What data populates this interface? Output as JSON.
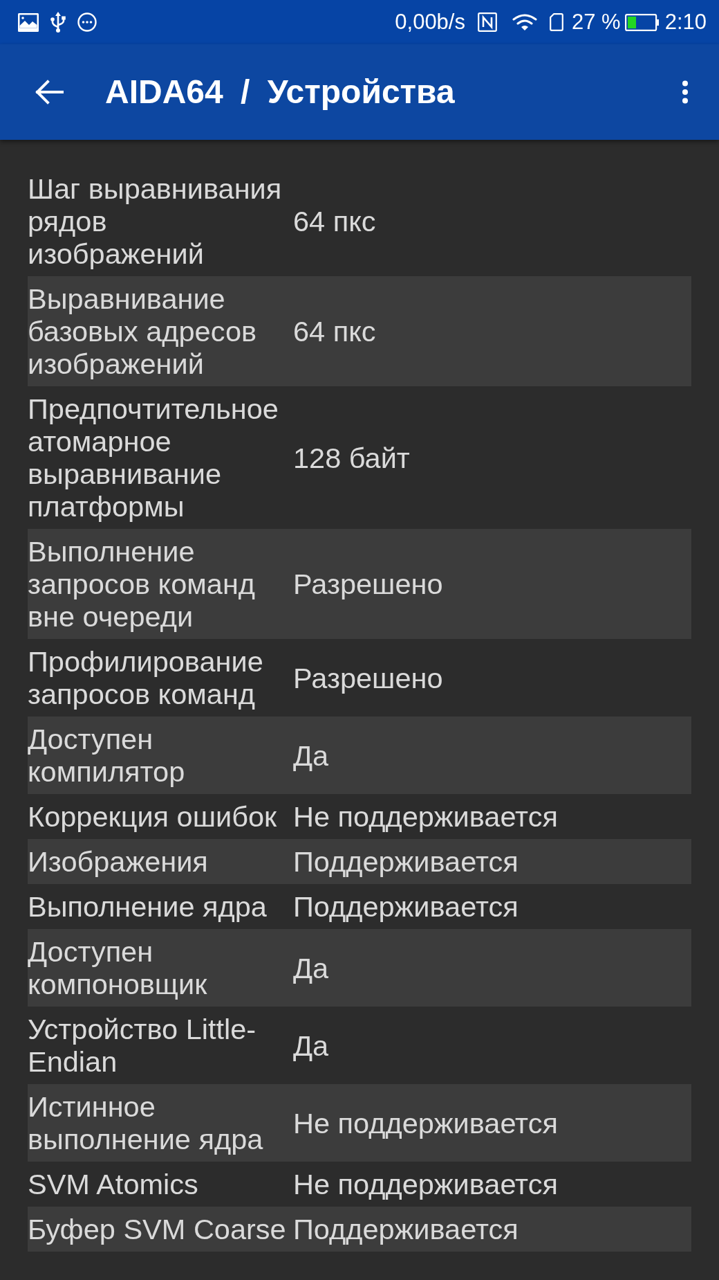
{
  "status_bar": {
    "network_speed": "0,00b/s",
    "battery_percent": "27 %",
    "time": "2:10"
  },
  "app_bar": {
    "title": "AIDA64 / Устройства"
  },
  "rows": [
    {
      "label": "Шаг выравнивания рядов изображений",
      "value": "64 пкс"
    },
    {
      "label": "Выравнивание базовых адресов изображений",
      "value": "64 пкс"
    },
    {
      "label": "Предпочтительное атомарное выравнивание платформы",
      "value": "128 байт"
    },
    {
      "label": "Выполнение запросов команд вне очереди",
      "value": "Разрешено"
    },
    {
      "label": "Профилирование запросов команд",
      "value": "Разрешено"
    },
    {
      "label": "Доступен компилятор",
      "value": "Да"
    },
    {
      "label": "Коррекция ошибок",
      "value": "Не поддерживается"
    },
    {
      "label": "Изображения",
      "value": "Поддерживается"
    },
    {
      "label": "Выполнение ядра",
      "value": "Поддерживается"
    },
    {
      "label": "Доступен компоновщик",
      "value": "Да"
    },
    {
      "label": "Устройство Little-Endian",
      "value": "Да"
    },
    {
      "label": "Истинное выполнение ядра",
      "value": "Не поддерживается"
    },
    {
      "label": "SVM Atomics",
      "value": "Не поддерживается"
    },
    {
      "label": "Буфер SVM Coarse",
      "value": "Поддерживается"
    }
  ]
}
